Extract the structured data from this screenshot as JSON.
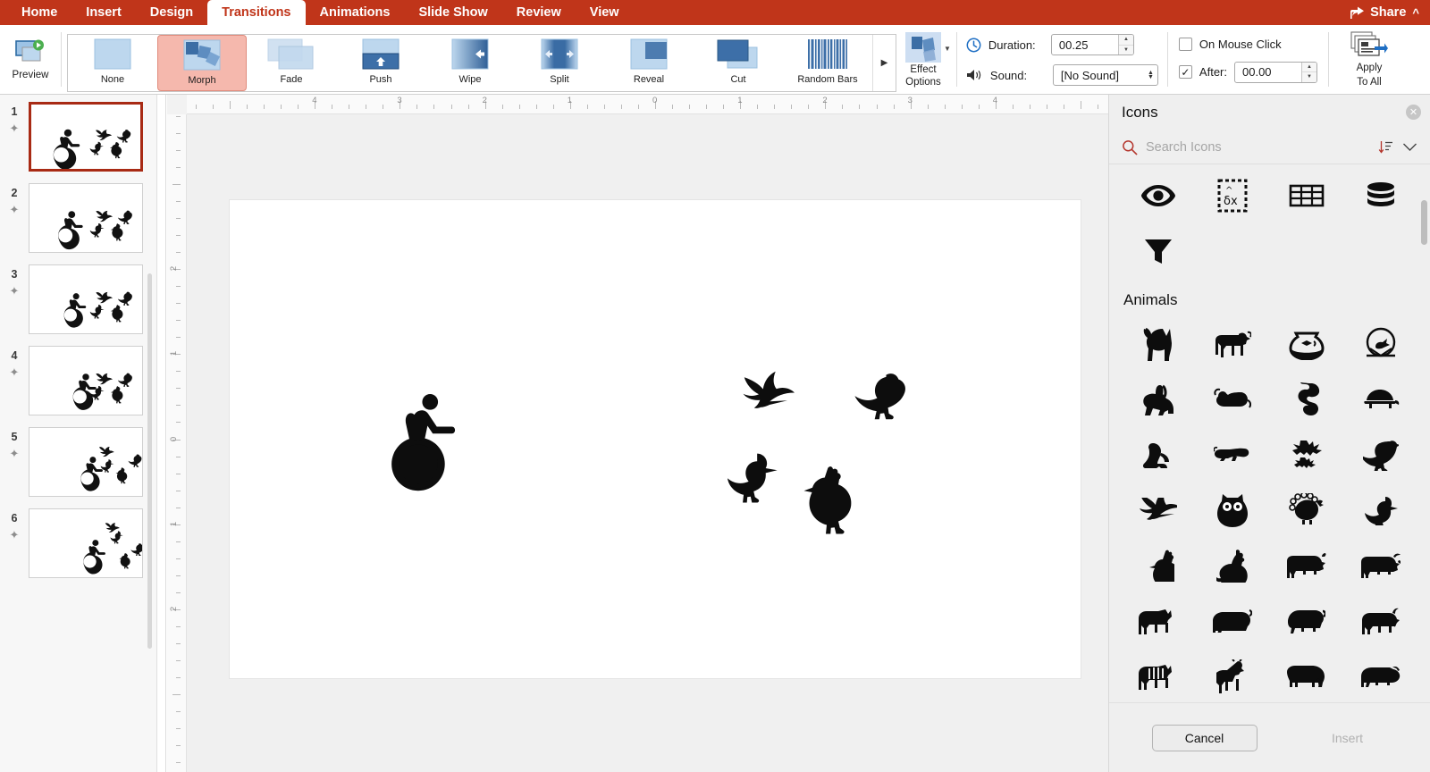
{
  "menubar": {
    "tabs": [
      {
        "label": "Home",
        "active": false
      },
      {
        "label": "Insert",
        "active": false
      },
      {
        "label": "Design",
        "active": false
      },
      {
        "label": "Transitions",
        "active": true
      },
      {
        "label": "Animations",
        "active": false
      },
      {
        "label": "Slide Show",
        "active": false
      },
      {
        "label": "Review",
        "active": false
      },
      {
        "label": "View",
        "active": false
      }
    ],
    "share_label": "Share",
    "collapse_icon": "chevron-up-icon",
    "share_icon": "share-icon",
    "accent_color": "#c0351a"
  },
  "ribbon": {
    "preview": {
      "label": "Preview",
      "icon": "preview-play-icon"
    },
    "transitions": [
      {
        "label": "None",
        "kind": "none",
        "selected": false
      },
      {
        "label": "Morph",
        "kind": "morph",
        "selected": true
      },
      {
        "label": "Fade",
        "kind": "fade",
        "selected": false
      },
      {
        "label": "Push",
        "kind": "push",
        "selected": false
      },
      {
        "label": "Wipe",
        "kind": "wipe",
        "selected": false
      },
      {
        "label": "Split",
        "kind": "split",
        "selected": false
      },
      {
        "label": "Reveal",
        "kind": "reveal",
        "selected": false
      },
      {
        "label": "Cut",
        "kind": "cut",
        "selected": false
      },
      {
        "label": "Random Bars",
        "kind": "randombars",
        "selected": false
      }
    ],
    "gallery_more_icon": "gallery-more-arrow-icon",
    "effect_options": {
      "label_line1": "Effect",
      "label_line2": "Options",
      "caret_icon": "caret-down-icon"
    },
    "duration": {
      "label": "Duration:",
      "value": "00.25",
      "icon": "clock-icon"
    },
    "sound": {
      "label": "Sound:",
      "value": "[No Sound]",
      "icon": "speaker-icon"
    },
    "on_mouse_click": {
      "label": "On Mouse Click",
      "checked": false
    },
    "after": {
      "label": "After:",
      "checked": true,
      "value": "00.00"
    },
    "apply_to_all": {
      "label_line1": "Apply",
      "label_line2": "To All",
      "icon": "apply-to-all-icon"
    }
  },
  "slides": [
    {
      "number": "1",
      "active": true
    },
    {
      "number": "2",
      "active": false
    },
    {
      "number": "3",
      "active": false
    },
    {
      "number": "4",
      "active": false
    },
    {
      "number": "5",
      "active": false
    },
    {
      "number": "6",
      "active": false
    }
  ],
  "rulers": {
    "horizontal_labels": [
      "4",
      "3",
      "2",
      "1",
      "0",
      "1",
      "2",
      "3",
      "4"
    ],
    "vertical_labels": [
      "2",
      "1",
      "0",
      "1",
      "2"
    ],
    "units": "inches"
  },
  "canvas": {
    "shapes": [
      {
        "name": "accessibility-wheelchair-icon"
      },
      {
        "name": "hummingbird-icon"
      },
      {
        "name": "crow-bird-icon"
      },
      {
        "name": "duck-icon"
      },
      {
        "name": "chicken-icon"
      }
    ]
  },
  "icons_panel": {
    "title": "Icons",
    "close_icon": "close-icon",
    "search_placeholder": "Search Icons",
    "search_value": "",
    "search_icon": "search-icon",
    "sort_icon": "sort-descending-icon",
    "expand_icon": "chevron-down-icon",
    "top_row_icons": [
      {
        "name": "eye-icon"
      },
      {
        "name": "data-analysis-icon"
      },
      {
        "name": "table-grid-icon"
      },
      {
        "name": "database-icon"
      },
      {
        "name": "funnel-filter-icon"
      }
    ],
    "category": "Animals",
    "animal_icons": [
      {
        "name": "cat-icon"
      },
      {
        "name": "dog-icon"
      },
      {
        "name": "fishbowl-icon"
      },
      {
        "name": "hamster-wheel-icon"
      },
      {
        "name": "rabbit-icon"
      },
      {
        "name": "mouse-icon"
      },
      {
        "name": "snake-icon"
      },
      {
        "name": "turtle-icon"
      },
      {
        "name": "frog-icon"
      },
      {
        "name": "lizard-icon"
      },
      {
        "name": "bats-icon"
      },
      {
        "name": "crow-icon"
      },
      {
        "name": "hummingbird-icon"
      },
      {
        "name": "owl-icon"
      },
      {
        "name": "peacock-icon"
      },
      {
        "name": "duck-icon"
      },
      {
        "name": "chicken-icon"
      },
      {
        "name": "rooster-icon"
      },
      {
        "name": "cow-icon"
      },
      {
        "name": "bull-icon"
      },
      {
        "name": "horse-icon"
      },
      {
        "name": "pig-icon"
      },
      {
        "name": "sheep-icon"
      },
      {
        "name": "goat-icon"
      },
      {
        "name": "zebra-icon"
      },
      {
        "name": "giraffe-icon"
      },
      {
        "name": "elephant-icon"
      },
      {
        "name": "rhinoceros-icon"
      }
    ],
    "cancel_label": "Cancel",
    "insert_label": "Insert",
    "insert_enabled": false
  }
}
